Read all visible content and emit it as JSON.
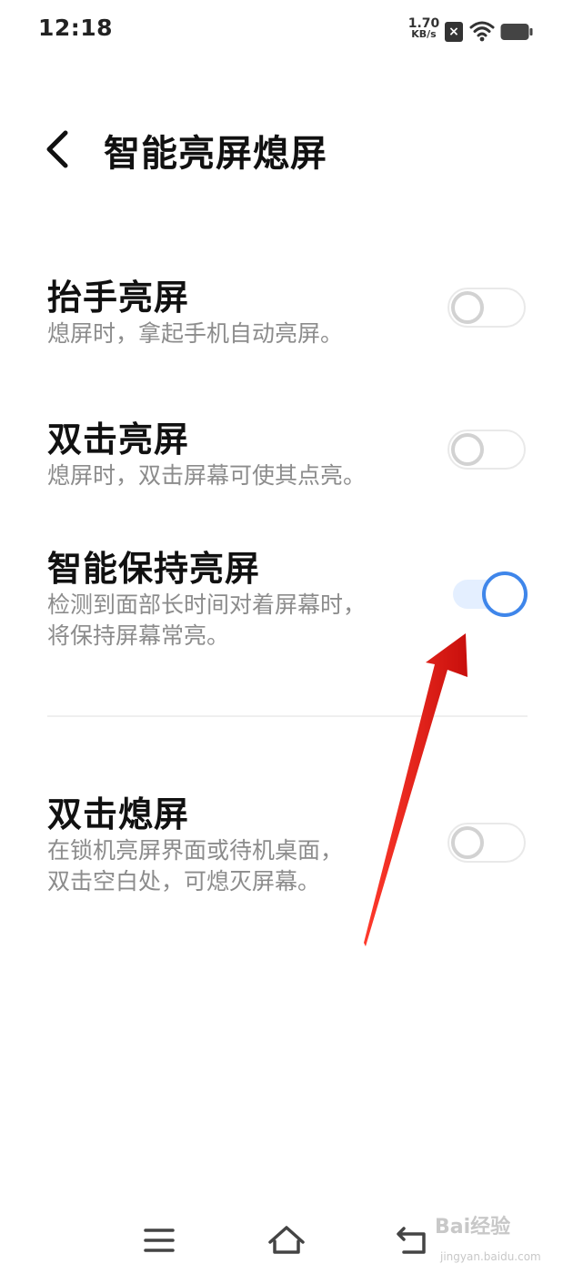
{
  "status_bar": {
    "time": "12:18",
    "net_speed_value": "1.70",
    "net_speed_unit": "KB/s",
    "sim_icon": "sim-no-service-icon",
    "wifi_icon": "wifi-icon",
    "battery_icon": "battery-icon"
  },
  "header": {
    "back_icon": "chevron-left-icon",
    "title": "智能亮屏熄屏"
  },
  "settings": [
    {
      "title": "抬手亮屏",
      "desc_lines": [
        "熄屏时，拿起手机自动亮屏。"
      ],
      "enabled": false
    },
    {
      "title": "双击亮屏",
      "desc_lines": [
        "熄屏时，双击屏幕可使其点亮。"
      ],
      "enabled": false
    },
    {
      "title": "智能保持亮屏",
      "desc_lines": [
        "检测到面部长时间对着屏幕时，",
        "将保持屏幕常亮。"
      ],
      "enabled": true
    },
    {
      "title": "双击熄屏",
      "desc_lines": [
        "在锁机亮屏界面或待机桌面，",
        "双击空白处，可熄灭屏幕。"
      ],
      "enabled": false
    }
  ],
  "annotation": {
    "arrow_color": "#e8201a"
  },
  "colors": {
    "accent": "#3f86ea",
    "toggle_on_track": "#e4efff",
    "toggle_off_knob": "#d2d2d2",
    "desc_text": "#8c8c8c"
  },
  "nav_bar": {
    "menu_icon": "menu-icon",
    "home_icon": "home-icon",
    "back_icon": "back-return-icon"
  },
  "watermark": {
    "logo": "Bai经验",
    "url": "jingyan.baidu.com"
  }
}
